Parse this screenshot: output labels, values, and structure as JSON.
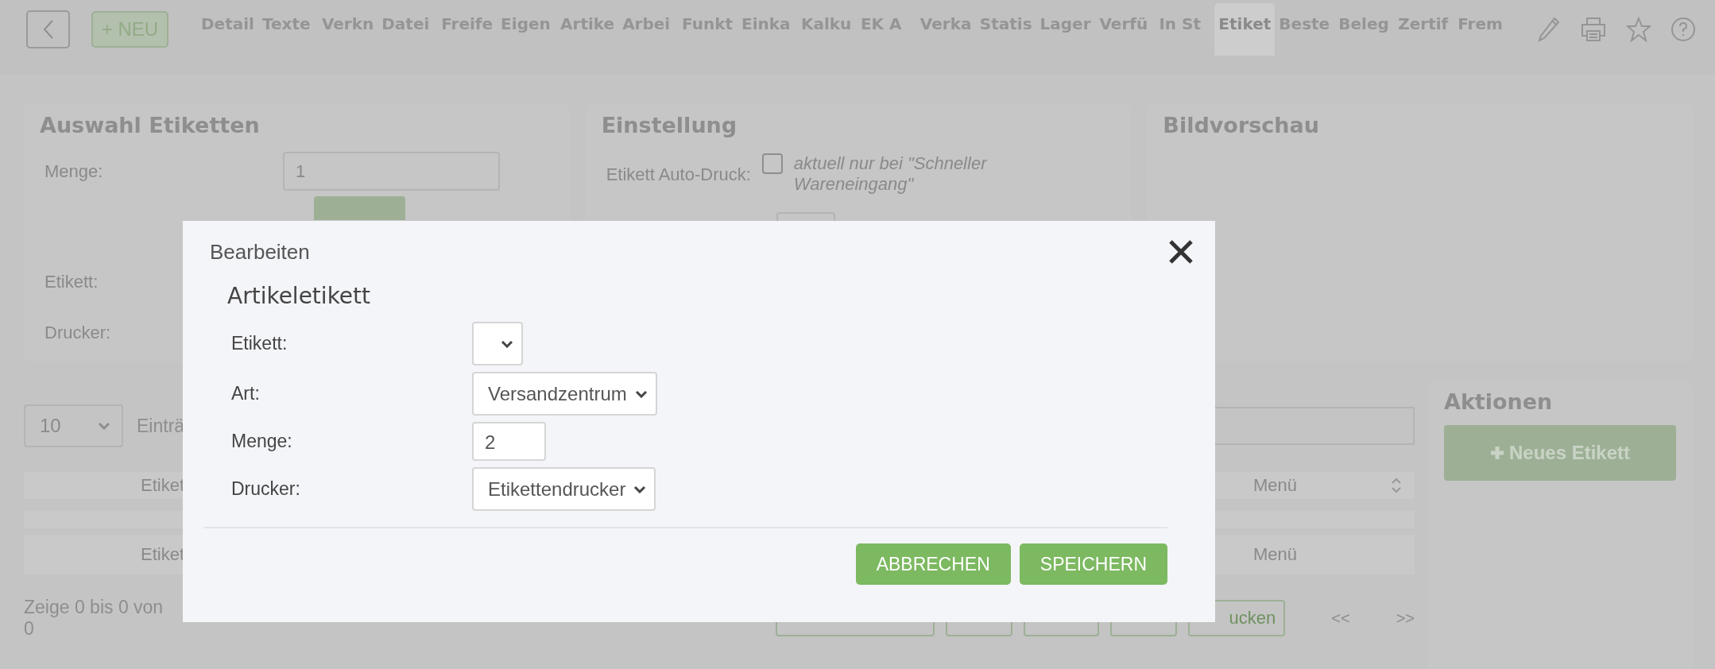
{
  "toolbar": {
    "new_button": "+ NEU",
    "tabs": [
      {
        "label": "Detail",
        "selected": false
      },
      {
        "label": "Texte",
        "selected": false
      },
      {
        "label": "Verkn",
        "selected": false
      },
      {
        "label": "Datei",
        "selected": false
      },
      {
        "label": "Freife",
        "selected": false
      },
      {
        "label": "Eigen",
        "selected": false
      },
      {
        "label": "Artike",
        "selected": false
      },
      {
        "label": "Arbei",
        "selected": false
      },
      {
        "label": "Funkt",
        "selected": false
      },
      {
        "label": "Einka",
        "selected": false
      },
      {
        "label": "Kalku",
        "selected": false
      },
      {
        "label": "EK A",
        "selected": false
      },
      {
        "label": "Verka",
        "selected": false
      },
      {
        "label": "Statis",
        "selected": false
      },
      {
        "label": "Lager",
        "selected": false
      },
      {
        "label": "Verfü",
        "selected": false
      },
      {
        "label": "In St",
        "selected": false
      },
      {
        "label": "Etiket",
        "selected": true
      },
      {
        "label": "Beste",
        "selected": false
      },
      {
        "label": "Beleg",
        "selected": false
      },
      {
        "label": "Zertif",
        "selected": false
      },
      {
        "label": "Frem",
        "selected": false
      }
    ]
  },
  "auswahl": {
    "title": "Auswahl Etiketten",
    "menge_label": "Menge:",
    "menge_value": "1",
    "etikett_label": "Etikett:",
    "drucker_label": "Drucker:"
  },
  "einstellung": {
    "title": "Einstellung",
    "auto_druck_label": "Etikett Auto-Druck:",
    "auto_druck_checked": false,
    "auto_druck_note": "aktuell nur bei \"Schneller Wareneingang\""
  },
  "bildvorschau": {
    "title": "Bildvorschau"
  },
  "table": {
    "page_size": "10",
    "entries_label": "Einträ",
    "header": [
      "Etiket",
      "Menü"
    ],
    "rows": [
      [
        "Etiket",
        "Menü"
      ]
    ],
    "footer": "Zeige 0 bis 0 von 0",
    "print_button": "ucken",
    "prev": "<<",
    "next": ">>"
  },
  "aktionen": {
    "title": "Aktionen",
    "new_button": "Neues Etikett"
  },
  "dialog": {
    "title": "Bearbeiten",
    "heading": "Artikeletikett",
    "fields": [
      {
        "kind": "select",
        "label": "Etikett:"
      },
      {
        "kind": "select",
        "label": "Art:",
        "value": "Versandzentrum"
      },
      {
        "kind": "input",
        "label": "Menge:",
        "value": "2"
      },
      {
        "kind": "select",
        "label": "Drucker:",
        "value": "Etikettendrucker"
      }
    ],
    "buttons": [
      "ABBRECHEN",
      "SPEICHERN"
    ]
  }
}
